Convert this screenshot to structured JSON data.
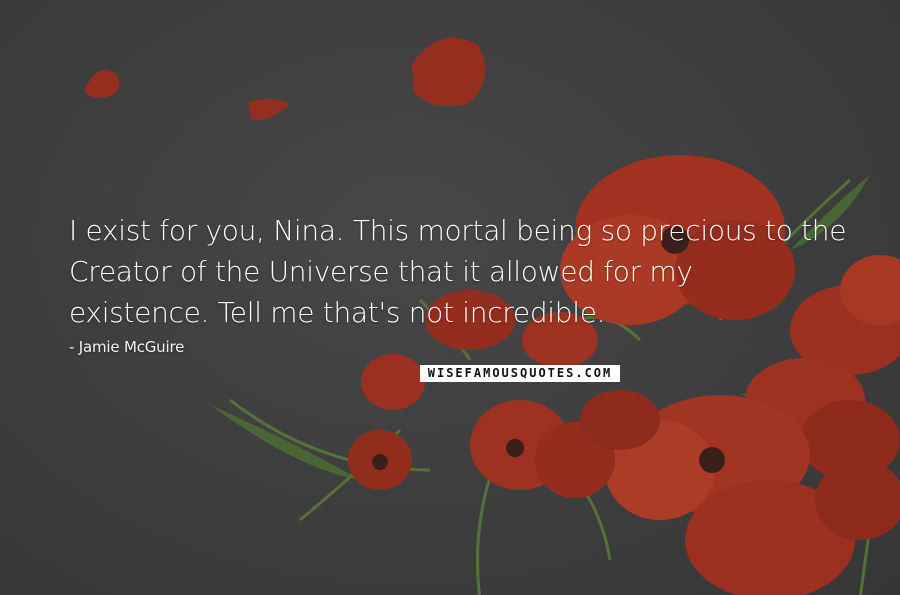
{
  "quote": {
    "line1": "I exist for you, Nina. This mortal being so precious to the",
    "line2": "Creator of the Universe that it allowed for my",
    "line3": "existence. Tell me that's not incredible."
  },
  "author": "- Jamie McGuire",
  "watermark": "WISEFAMOUSQUOTES.COM",
  "colors": {
    "background": "#3e3e3e",
    "petal": "#b8321e",
    "stem": "#5f8a3a",
    "text": "#ffffff"
  }
}
